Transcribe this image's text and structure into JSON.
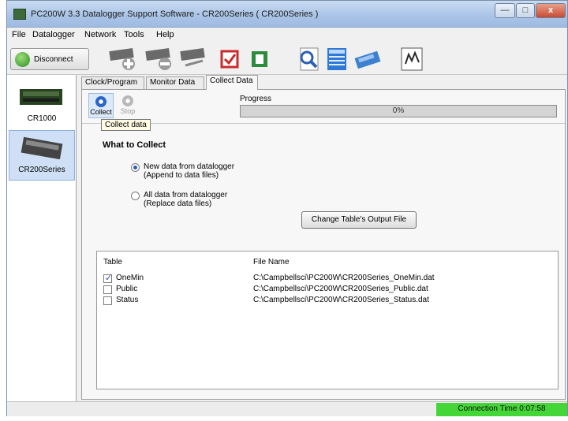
{
  "window": {
    "title": "PC200W 3.3 Datalogger Support Software - CR200Series ( CR200Series )",
    "controls": [
      "—",
      "□",
      "x"
    ]
  },
  "menu": [
    "File",
    "Datalogger",
    "Network",
    "Tools",
    "Help"
  ],
  "toolbar": {
    "disconnect_label": "Disconnect",
    "icons": [
      "add-datalogger-icon",
      "delete-datalogger-icon",
      "edit-datalogger-icon",
      "checklist-icon",
      "program-icon",
      "view-data-icon",
      "split-report-icon",
      "card-convert-icon",
      "short-cut-icon"
    ]
  },
  "stations": [
    {
      "label": "CR1000",
      "selected": false
    },
    {
      "label": "CR200Series",
      "selected": true
    }
  ],
  "tabs": [
    "Clock/Program",
    "Monitor Data",
    "Collect Data"
  ],
  "active_tab": "Collect Data",
  "collect": {
    "collect_label": "Collect",
    "stop_label": "Stop",
    "tooltip": "Collect data",
    "progress_label": "Progress",
    "progress_text": "0%",
    "progress_value": 0
  },
  "what_to_collect": {
    "title": "What to Collect",
    "options": [
      {
        "line1": "New data from datalogger",
        "line2": "(Append to data files)",
        "selected": true
      },
      {
        "line1": "All data from datalogger",
        "line2": "(Replace data files)",
        "selected": false
      }
    ]
  },
  "change_button": "Change Table's Output File",
  "table": {
    "headers": [
      "Table",
      "File Name"
    ],
    "rows": [
      {
        "name": "OneMin",
        "file": "C:\\Campbellsci\\PC200W\\CR200Series_OneMin.dat",
        "checked": true
      },
      {
        "name": "Public",
        "file": "C:\\Campbellsci\\PC200W\\CR200Series_Public.dat",
        "checked": false
      },
      {
        "name": "Status",
        "file": "C:\\Campbellsci\\PC200W\\CR200Series_Status.dat",
        "checked": false
      }
    ]
  },
  "status": {
    "connection_time": "Connection Time 0:07:58",
    "color": "#44d636"
  }
}
